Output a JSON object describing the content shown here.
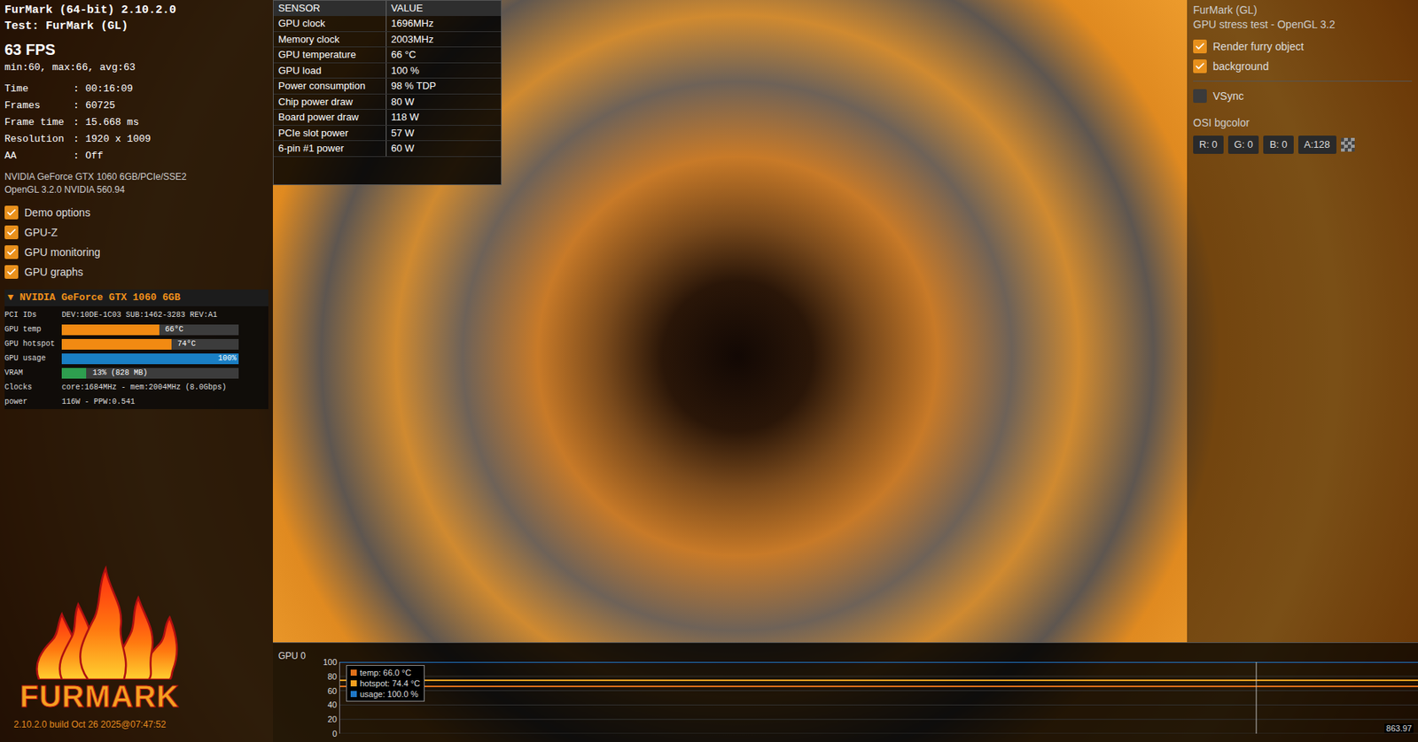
{
  "app": {
    "title": "FurMark (64-bit) 2.10.2.0",
    "test": "Test: FurMark (GL)",
    "fps": "63 FPS",
    "fps_stats": "min:60, max:66, avg:63"
  },
  "info_separator": ":",
  "info_rows": [
    {
      "label": "Time",
      "value": "00:16:09"
    },
    {
      "label": "Frames",
      "value": "60725"
    },
    {
      "label": "Frame time",
      "value": "15.668 ms"
    },
    {
      "label": "Resolution",
      "value": "1920 x 1009"
    },
    {
      "label": "AA",
      "value": "Off"
    }
  ],
  "gpu_name": "NVIDIA GeForce GTX 1060 6GB/PCIe/SSE2",
  "opengl": "OpenGL 3.2.0 NVIDIA 560.94",
  "options": [
    {
      "label": "Demo options",
      "checked": true
    },
    {
      "label": "GPU-Z",
      "checked": true
    },
    {
      "label": "GPU monitoring",
      "checked": true
    },
    {
      "label": "GPU graphs",
      "checked": true
    }
  ],
  "gpu_panel": {
    "toggle": "▼",
    "title": "NVIDIA GeForce GTX 1060 6GB",
    "rows": [
      {
        "kind": "text",
        "label": "PCI IDs",
        "value": "DEV:10DE-1C03 SUB:1462-3283 REV:A1"
      },
      {
        "kind": "bar",
        "label": "GPU temp",
        "value": "66°C",
        "level": 0.55,
        "color": "#f28a12"
      },
      {
        "kind": "bar",
        "label": "GPU hotspot",
        "value": "74°C",
        "level": 0.62,
        "color": "#f28a12"
      },
      {
        "kind": "bar",
        "label": "GPU usage",
        "value": "100%",
        "level": 1.0,
        "color": "#1a7fc4"
      },
      {
        "kind": "bar",
        "label": "VRAM",
        "value": "13% (828 MB)",
        "level": 0.14,
        "color": "#2e9e4f"
      },
      {
        "kind": "text",
        "label": "Clocks",
        "value": "core:1684MHz - mem:2004MHz (8.0Gbps)"
      },
      {
        "kind": "text",
        "label": "power",
        "value": "116W - PPW:0.541"
      }
    ]
  },
  "logo": "FURMARK",
  "build": "2.10.2.0 build Oct 26 2025@07:47:52",
  "sensors": {
    "columns": [
      "SENSOR",
      "VALUE"
    ],
    "rows": [
      [
        "GPU clock",
        "1696MHz"
      ],
      [
        "Memory clock",
        "2003MHz"
      ],
      [
        "GPU temperature",
        "66 °C"
      ],
      [
        "GPU load",
        "100 %"
      ],
      [
        "Power consumption",
        "98 % TDP"
      ],
      [
        "Chip power draw",
        "80 W"
      ],
      [
        "Board power draw",
        "118 W"
      ],
      [
        "PCIe slot power",
        "57 W"
      ],
      [
        "6-pin #1 power",
        "60 W"
      ]
    ]
  },
  "right_panel": {
    "title": "FurMark (GL)",
    "subtitle": "GPU stress test - OpenGL 3.2",
    "options": [
      {
        "label": "Render furry object",
        "checked": true
      },
      {
        "label": "background",
        "checked": true
      },
      {
        "label": "VSync",
        "checked": false
      }
    ],
    "bgcolor_label": "OSI bgcolor",
    "fields": [
      "R: 0",
      "G: 0",
      "B: 0",
      "A:128"
    ]
  },
  "graph": {
    "title": "GPU 0",
    "y_ticks": [
      "100",
      "80",
      "60",
      "40",
      "20",
      "0"
    ],
    "x_reading": "863.97",
    "series": [
      {
        "name": "usage",
        "legend": "usage: 100.0 %",
        "color": "#1f78c8",
        "values": [
          100,
          100,
          100,
          100,
          100,
          100,
          100,
          100,
          100,
          100,
          100,
          100,
          100,
          100,
          100,
          100,
          100,
          100,
          100,
          100
        ]
      },
      {
        "name": "hotspot",
        "legend": "hotspot: 74.4 °C",
        "color": "#f5a020",
        "values": [
          74.4,
          74.4,
          74.4,
          74.4,
          74.4,
          74.4,
          74.4,
          74.4,
          74.4,
          74.4,
          74.4,
          74.4,
          74.4,
          74.4,
          74.4,
          74.4,
          74.4,
          74.4,
          74.4,
          74.4
        ]
      },
      {
        "name": "temp",
        "legend": "temp: 66.0 °C",
        "color": "#e0701a",
        "values": [
          66,
          66,
          66,
          66,
          66,
          66,
          66,
          66,
          66,
          66,
          66,
          66,
          66,
          66,
          66,
          66,
          66,
          66,
          66,
          66
        ]
      }
    ]
  }
}
